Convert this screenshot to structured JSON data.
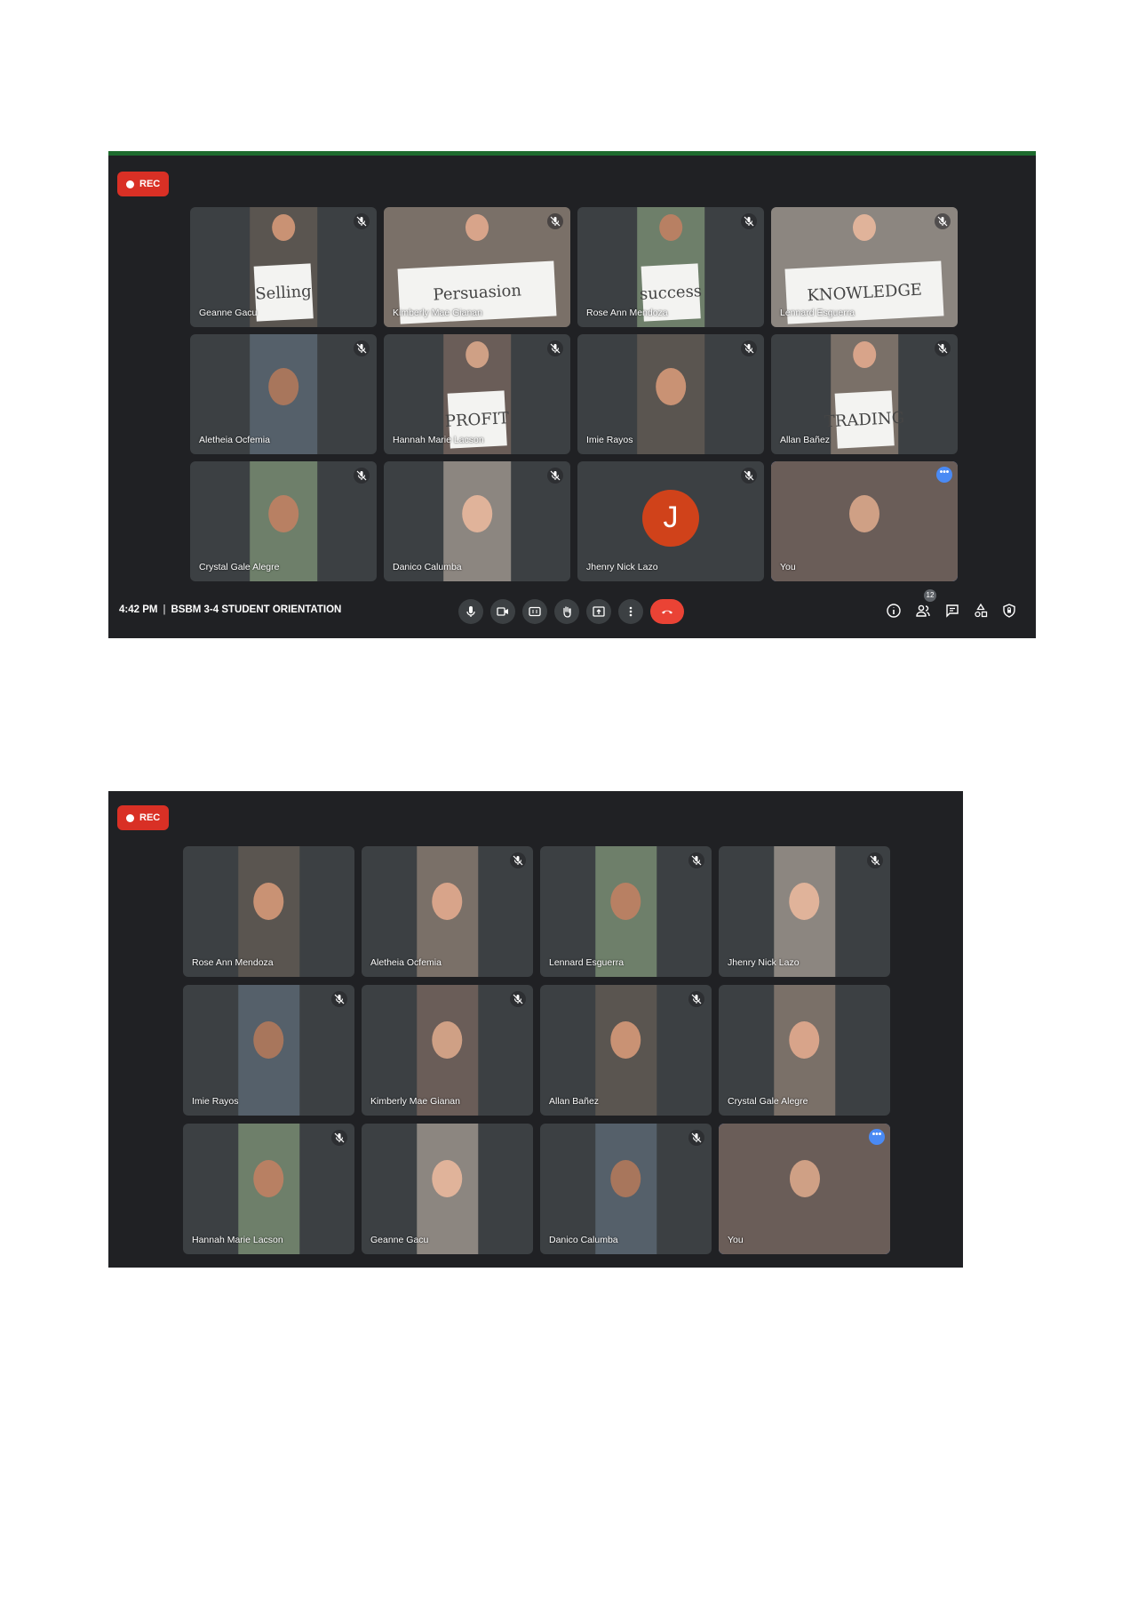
{
  "screenshot1": {
    "rec_label": "REC",
    "participants": [
      {
        "name": "Geanne Gacu",
        "sign": "Selling",
        "muted": true
      },
      {
        "name": "Kimberly Mae Gianan",
        "sign": "Persuasion",
        "muted": true
      },
      {
        "name": "Rose Ann Mendoza",
        "sign": "success",
        "muted": true
      },
      {
        "name": "Lennard Esguerra",
        "sign": "KNOWLEDGE",
        "muted": true
      },
      {
        "name": "Aletheia Ocfemia",
        "sign": "",
        "muted": true
      },
      {
        "name": "Hannah Marie Lacson",
        "sign": "PROFIT",
        "muted": true
      },
      {
        "name": "Imie Rayos",
        "sign": "",
        "muted": true
      },
      {
        "name": "Allan Bañez",
        "sign": "TRADING",
        "muted": true
      },
      {
        "name": "Crystal Gale Alegre",
        "sign": "",
        "muted": true
      },
      {
        "name": "Danico Calumba",
        "sign": "",
        "muted": true
      },
      {
        "name": "Jhenry Nick Lazo",
        "sign": "",
        "avatar_letter": "J",
        "muted": true
      },
      {
        "name": "You",
        "sign": "",
        "self": true
      }
    ],
    "time": "4:42 PM",
    "separator": "|",
    "meeting_title": "BSBM 3-4 STUDENT ORIENTATION",
    "participant_count": "12"
  },
  "screenshot2": {
    "rec_label": "REC",
    "participants": [
      {
        "name": "Rose Ann Mendoza",
        "muted": false
      },
      {
        "name": "Aletheia Ocfemia",
        "muted": true
      },
      {
        "name": "Lennard Esguerra",
        "muted": true
      },
      {
        "name": "Jhenry Nick Lazo",
        "muted": true
      },
      {
        "name": "Imie Rayos",
        "muted": true
      },
      {
        "name": "Kimberly Mae Gianan",
        "muted": true
      },
      {
        "name": "Allan Bañez",
        "muted": true
      },
      {
        "name": "Crystal Gale Alegre",
        "muted": false
      },
      {
        "name": "Hannah Marie Lacson",
        "muted": true
      },
      {
        "name": "Geanne Gacu",
        "muted": false
      },
      {
        "name": "Danico Calumba",
        "muted": true
      },
      {
        "name": "You",
        "self": true
      }
    ]
  },
  "icons": {
    "rec": "record-dot-icon",
    "mic_off": "mic-off-icon",
    "more": "more-options-icon"
  },
  "colors": {
    "background": "#202124",
    "tile": "#3c4043",
    "rec": "#d93025",
    "end_call": "#ea4335",
    "self_highlight": "#4a8af4",
    "avatar": "#d0421a"
  }
}
